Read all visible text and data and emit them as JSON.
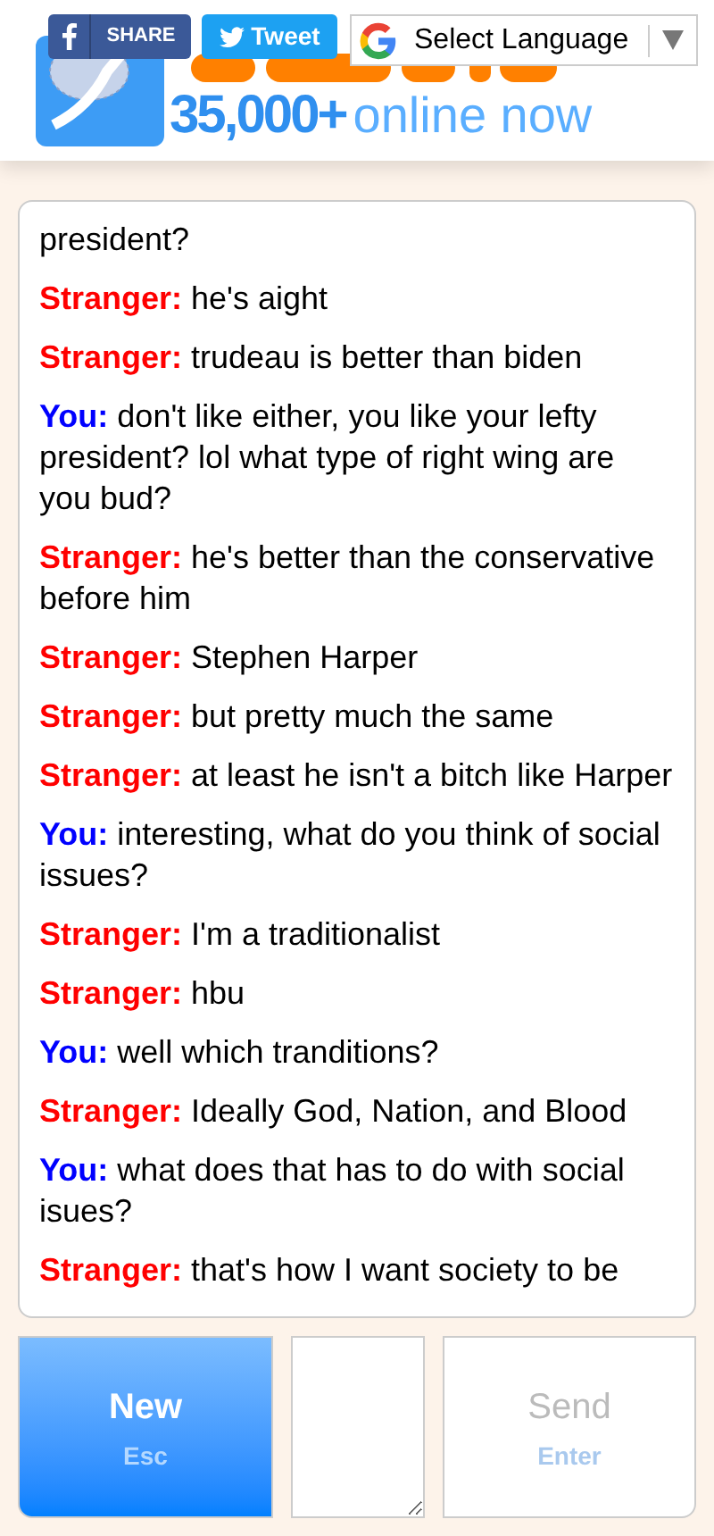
{
  "header": {
    "share_button": "SHARE",
    "tweet_button": "Tweet",
    "language_select": "Select Language",
    "online_count": "35,000+",
    "online_label": "online now"
  },
  "chat": {
    "messages": [
      {
        "kind": "continuation",
        "text": "president?"
      },
      {
        "kind": "stranger",
        "speaker": "Stranger:",
        "text": "he's aight"
      },
      {
        "kind": "stranger",
        "speaker": "Stranger:",
        "text": "trudeau is better than biden"
      },
      {
        "kind": "you",
        "speaker": "You:",
        "text": "don't like either, you like your lefty president? lol what type of right wing are you bud?"
      },
      {
        "kind": "stranger",
        "speaker": "Stranger:",
        "text": "he's better than the conservative before him"
      },
      {
        "kind": "stranger",
        "speaker": "Stranger:",
        "text": "Stephen Harper"
      },
      {
        "kind": "stranger",
        "speaker": "Stranger:",
        "text": "but pretty much the same"
      },
      {
        "kind": "stranger",
        "speaker": "Stranger:",
        "text": "at least he isn't a bitch like Harper"
      },
      {
        "kind": "you",
        "speaker": "You:",
        "text": "interesting, what do you think of social issues?"
      },
      {
        "kind": "stranger",
        "speaker": "Stranger:",
        "text": "I'm a traditionalist"
      },
      {
        "kind": "stranger",
        "speaker": "Stranger:",
        "text": "hbu"
      },
      {
        "kind": "you",
        "speaker": "You:",
        "text": "well which tranditions?"
      },
      {
        "kind": "stranger",
        "speaker": "Stranger:",
        "text": "Ideally God, Nation, and Blood"
      },
      {
        "kind": "you",
        "speaker": "You:",
        "text": "what does that has to do with social isues?"
      },
      {
        "kind": "stranger",
        "speaker": "Stranger:",
        "text": "that's how I want society to be"
      }
    ]
  },
  "controls": {
    "new_button": {
      "label": "New",
      "hint": "Esc"
    },
    "send_button": {
      "label": "Send",
      "hint": "Enter",
      "disabled": true
    }
  }
}
